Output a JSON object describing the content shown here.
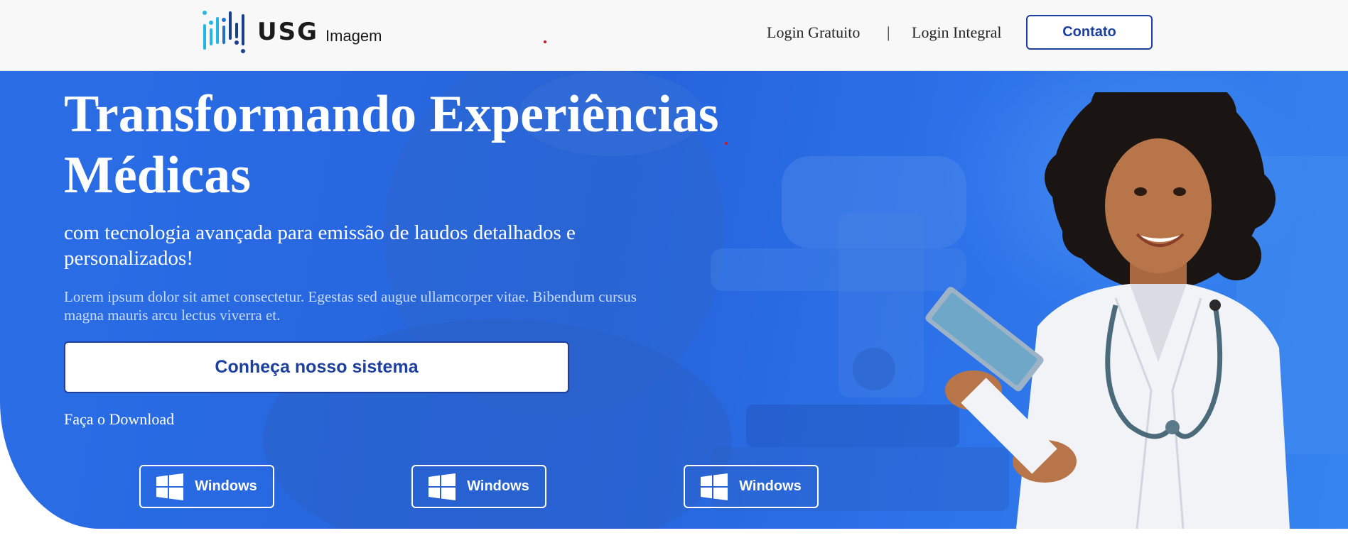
{
  "header": {
    "logo": {
      "brand": "USG",
      "sub": "Imagem"
    },
    "nav": {
      "login_gratuito": "Login Gratuito",
      "separator": "|",
      "login_integral": "Login Integral"
    },
    "contact_button": "Contato"
  },
  "hero": {
    "title": "Transformando Experiências Médicas",
    "subtitle": "com tecnologia avançada para emissão de laudos detalhados e personalizados!",
    "body": "Lorem ipsum dolor sit amet consectetur. Egestas sed augue ullamcorper vitae. Bibendum cursus magna mauris arcu lectus viverra et.",
    "cta_button": "Conheça nosso sistema",
    "download_label": "Faça o Download",
    "download_buttons": [
      {
        "label": "Windows",
        "icon": "windows-icon"
      },
      {
        "label": "Windows",
        "icon": "windows-icon"
      },
      {
        "label": "Windows",
        "icon": "windows-icon"
      }
    ]
  },
  "colors": {
    "hero_blue": "#2563dc",
    "brand_navy": "#1d3f9e",
    "logo_cyan": "#25b6e8",
    "logo_dark": "#1b3f8f",
    "header_bg": "#f8f8f8"
  }
}
